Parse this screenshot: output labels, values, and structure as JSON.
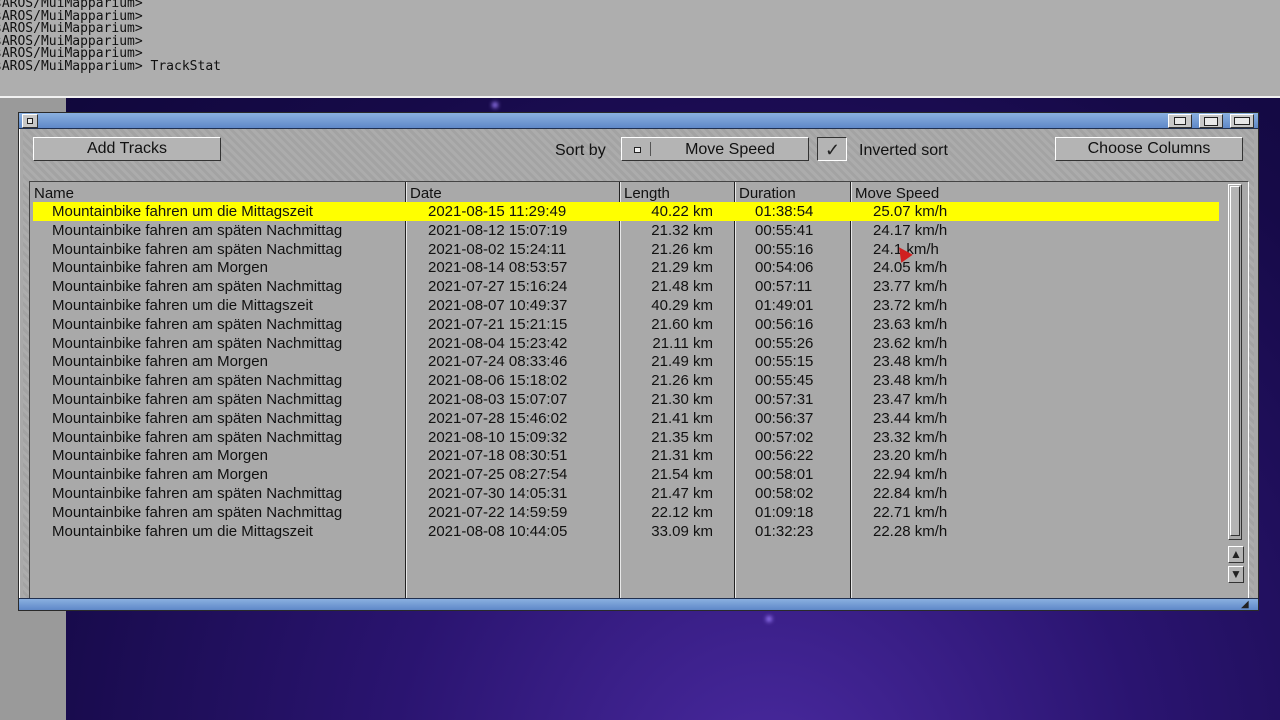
{
  "shell": {
    "lines": [
      "sAROS/MuiMapparium>",
      "sAROS/MuiMapparium>",
      "sAROS/MuiMapparium>",
      "sAROS/MuiMapparium>",
      "sAROS/MuiMapparium>",
      "sAROS/MuiMapparium> TrackStat"
    ]
  },
  "toolbar": {
    "add_tracks_label": "Add Tracks",
    "sort_by_label": "Sort by",
    "sort_value": "Move Speed",
    "inverted_sort_label": "Inverted sort",
    "inverted_sort_checked": true,
    "choose_columns_label": "Choose Columns"
  },
  "columns": {
    "name": "Name",
    "date": "Date",
    "length": "Length",
    "duration": "Duration",
    "move_speed": "Move Speed"
  },
  "selected_row": 0,
  "rows": [
    {
      "name": "Mountainbike fahren um die Mittagszeit",
      "date": "2021-08-15 11:29:49",
      "length": "40.22 km",
      "duration": "01:38:54",
      "speed": "25.07 km/h"
    },
    {
      "name": "Mountainbike fahren am späten Nachmittag",
      "date": "2021-08-12 15:07:19",
      "length": "21.32 km",
      "duration": "00:55:41",
      "speed": "24.17 km/h"
    },
    {
      "name": "Mountainbike fahren am späten Nachmittag",
      "date": "2021-08-02 15:24:11",
      "length": "21.26 km",
      "duration": "00:55:16",
      "speed": "24.1  km/h"
    },
    {
      "name": "Mountainbike fahren am Morgen",
      "date": "2021-08-14 08:53:57",
      "length": "21.29 km",
      "duration": "00:54:06",
      "speed": "24.05 km/h"
    },
    {
      "name": "Mountainbike fahren am späten Nachmittag",
      "date": "2021-07-27 15:16:24",
      "length": "21.48 km",
      "duration": "00:57:11",
      "speed": "23.77 km/h"
    },
    {
      "name": "Mountainbike fahren um die Mittagszeit",
      "date": "2021-08-07 10:49:37",
      "length": "40.29 km",
      "duration": "01:49:01",
      "speed": "23.72 km/h"
    },
    {
      "name": "Mountainbike fahren am späten Nachmittag",
      "date": "2021-07-21 15:21:15",
      "length": "21.60 km",
      "duration": "00:56:16",
      "speed": "23.63 km/h"
    },
    {
      "name": "Mountainbike fahren am späten Nachmittag",
      "date": "2021-08-04 15:23:42",
      "length": "21.11 km",
      "duration": "00:55:26",
      "speed": "23.62 km/h"
    },
    {
      "name": "Mountainbike fahren am Morgen",
      "date": "2021-07-24 08:33:46",
      "length": "21.49 km",
      "duration": "00:55:15",
      "speed": "23.48 km/h"
    },
    {
      "name": "Mountainbike fahren am späten Nachmittag",
      "date": "2021-08-06 15:18:02",
      "length": "21.26 km",
      "duration": "00:55:45",
      "speed": "23.48 km/h"
    },
    {
      "name": "Mountainbike fahren am späten Nachmittag",
      "date": "2021-08-03 15:07:07",
      "length": "21.30 km",
      "duration": "00:57:31",
      "speed": "23.47 km/h"
    },
    {
      "name": "Mountainbike fahren am späten Nachmittag",
      "date": "2021-07-28 15:46:02",
      "length": "21.41 km",
      "duration": "00:56:37",
      "speed": "23.44 km/h"
    },
    {
      "name": "Mountainbike fahren am späten Nachmittag",
      "date": "2021-08-10 15:09:32",
      "length": "21.35 km",
      "duration": "00:57:02",
      "speed": "23.32 km/h"
    },
    {
      "name": "Mountainbike fahren am Morgen",
      "date": "2021-07-18 08:30:51",
      "length": "21.31 km",
      "duration": "00:56:22",
      "speed": "23.20 km/h"
    },
    {
      "name": "Mountainbike fahren am Morgen",
      "date": "2021-07-25 08:27:54",
      "length": "21.54 km",
      "duration": "00:58:01",
      "speed": "22.94 km/h"
    },
    {
      "name": "Mountainbike fahren am späten Nachmittag",
      "date": "2021-07-30 14:05:31",
      "length": "21.47 km",
      "duration": "00:58:02",
      "speed": "22.84 km/h"
    },
    {
      "name": "Mountainbike fahren am späten Nachmittag",
      "date": "2021-07-22 14:59:59",
      "length": "22.12 km",
      "duration": "01:09:18",
      "speed": "22.71 km/h"
    },
    {
      "name": "Mountainbike fahren um die Mittagszeit",
      "date": "2021-08-08 10:44:05",
      "length": "33.09 km",
      "duration": "01:32:23",
      "speed": "22.28 km/h"
    }
  ],
  "colors": {
    "selection": "#ffff00",
    "title_bar": "#6f98d4",
    "window_bg": "#a9a9a9",
    "desktop": "#1e0e5a"
  },
  "icons": {
    "close": "close-icon",
    "depth": "depth-icon",
    "zoom": "zoom-icon",
    "iconify": "iconify-icon",
    "cycle": "cycle-icon",
    "check": "check-icon",
    "scroll_up": "arrow-up-icon",
    "scroll_down": "arrow-down-icon",
    "resize": "resize-icon",
    "cursor": "mouse-pointer-icon"
  }
}
